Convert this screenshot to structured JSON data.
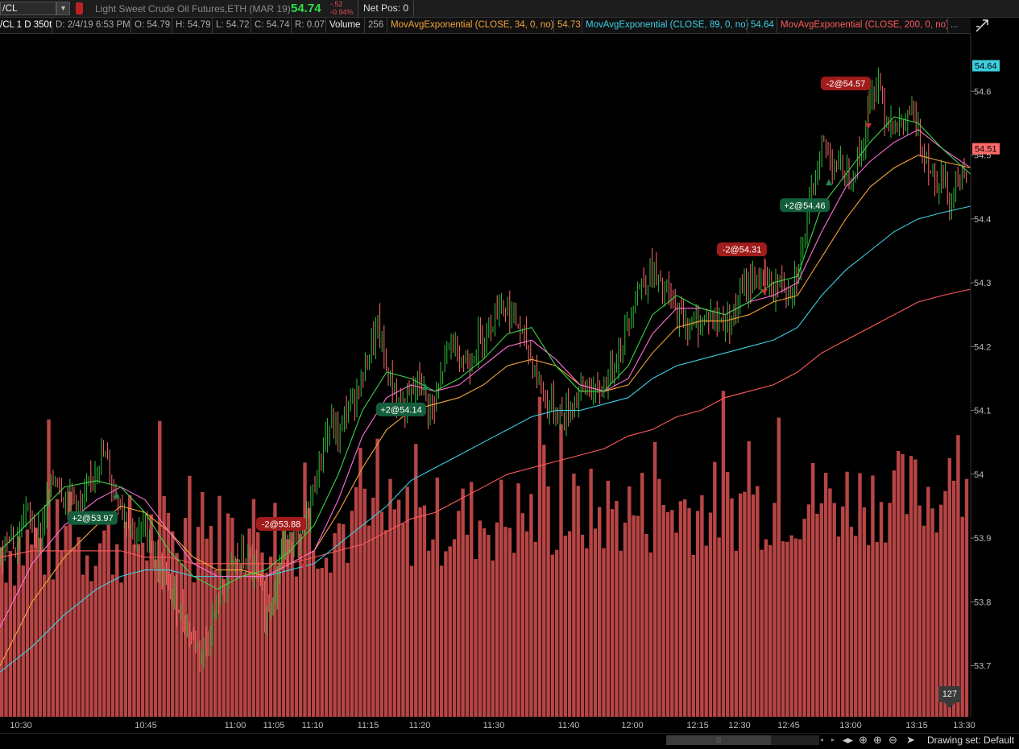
{
  "topbar": {
    "symbol": "/CL",
    "description": "Light Sweet Crude Oil Futures,ETH (MAR 19)",
    "last": "54.74",
    "net_change": "-.52",
    "pct_change": "-0.94%",
    "net_pos": "Net Pos: 0"
  },
  "infobar": {
    "label": "/CL 1 D 350t",
    "date": "D: 2/4/19 6:53 PM",
    "open": "O: 54.79",
    "high": "H: 54.79",
    "low": "L: 54.72",
    "close": "C: 54.74",
    "range": "R: 0.07",
    "volume_label": "Volume",
    "volume_value": "256",
    "ema34_label": "MovAvgExponential (CLOSE, 34, 0, no)",
    "ema34_value": "54.73",
    "ema89_label": "MovAvgExponential (CLOSE, 89, 0, no)",
    "ema89_value": "54.64",
    "ema200_label": "MovAvgExponential (CLOSE, 200, 0, no)",
    "more": "..."
  },
  "colors": {
    "up": "#2fbf3a",
    "down": "#ff6b6b",
    "volume": "#b84545",
    "ema_fast": "#3cd34a",
    "ema_pink": "#ff6fd8",
    "ema34": "#f2a33a",
    "ema89": "#3ccfe0",
    "ema200": "#ff5a5a",
    "buy_badge": "#155e3c",
    "sell_badge": "#a21c1c"
  },
  "chart_data": {
    "type": "candlestick",
    "y_ticks": [
      "54.6",
      "54.5",
      "54.4",
      "54.3",
      "54.2",
      "54.1",
      "54",
      "53.9",
      "53.8",
      "53.7"
    ],
    "ylim": [
      53.62,
      54.69
    ],
    "x_ticks": [
      "10:30",
      "10:45",
      "11:00",
      "11:05",
      "11:10",
      "11:15",
      "11:20",
      "11:30",
      "11:40",
      "12:00",
      "12:15",
      "12:30",
      "12:45",
      "13:00",
      "13:15",
      "13:30"
    ],
    "current_price_tag": "54.51",
    "ema89_tag": "54.64",
    "volume_badge": "127",
    "close_path": [
      [
        0,
        53.86
      ],
      [
        10,
        53.92
      ],
      [
        20,
        53.88
      ],
      [
        30,
        53.95
      ],
      [
        40,
        53.92
      ],
      [
        50,
        53.9
      ],
      [
        60,
        53.97
      ],
      [
        70,
        54.0
      ],
      [
        80,
        53.96
      ],
      [
        90,
        53.97
      ],
      [
        100,
        53.94
      ],
      [
        110,
        53.98
      ],
      [
        120,
        54.02
      ],
      [
        130,
        54.03
      ],
      [
        140,
        53.98
      ],
      [
        150,
        53.95
      ],
      [
        160,
        53.93
      ],
      [
        170,
        53.9
      ],
      [
        180,
        53.92
      ],
      [
        190,
        53.88
      ],
      [
        200,
        53.84
      ],
      [
        210,
        53.82
      ],
      [
        220,
        53.8
      ],
      [
        230,
        53.77
      ],
      [
        240,
        53.74
      ],
      [
        250,
        53.72
      ],
      [
        260,
        53.75
      ],
      [
        270,
        53.8
      ],
      [
        280,
        53.83
      ],
      [
        290,
        53.86
      ],
      [
        300,
        53.87
      ],
      [
        310,
        53.86
      ],
      [
        320,
        53.84
      ],
      [
        330,
        53.78
      ],
      [
        340,
        53.82
      ],
      [
        350,
        53.88
      ],
      [
        360,
        53.9
      ],
      [
        370,
        53.88
      ],
      [
        380,
        53.93
      ],
      [
        390,
        53.98
      ],
      [
        400,
        54.04
      ],
      [
        410,
        54.08
      ],
      [
        420,
        54.06
      ],
      [
        430,
        54.1
      ],
      [
        440,
        54.12
      ],
      [
        450,
        54.15
      ],
      [
        460,
        54.2
      ],
      [
        470,
        54.23
      ],
      [
        480,
        54.16
      ],
      [
        490,
        54.13
      ],
      [
        500,
        54.1
      ],
      [
        510,
        54.12
      ],
      [
        520,
        54.15
      ],
      [
        530,
        54.11
      ],
      [
        540,
        54.1
      ],
      [
        550,
        54.17
      ],
      [
        560,
        54.21
      ],
      [
        570,
        54.19
      ],
      [
        580,
        54.17
      ],
      [
        590,
        54.2
      ],
      [
        600,
        54.22
      ],
      [
        610,
        54.24
      ],
      [
        620,
        54.27
      ],
      [
        630,
        54.26
      ],
      [
        640,
        54.24
      ],
      [
        650,
        54.21
      ],
      [
        660,
        54.18
      ],
      [
        670,
        54.14
      ],
      [
        680,
        54.11
      ],
      [
        690,
        54.1
      ],
      [
        700,
        54.09
      ],
      [
        710,
        54.11
      ],
      [
        720,
        54.13
      ],
      [
        730,
        54.14
      ],
      [
        740,
        54.12
      ],
      [
        750,
        54.14
      ],
      [
        760,
        54.17
      ],
      [
        770,
        54.2
      ],
      [
        780,
        54.24
      ],
      [
        790,
        54.29
      ],
      [
        800,
        54.3
      ],
      [
        810,
        54.32
      ],
      [
        820,
        54.29
      ],
      [
        830,
        54.28
      ],
      [
        840,
        54.25
      ],
      [
        850,
        54.24
      ],
      [
        860,
        54.23
      ],
      [
        870,
        54.24
      ],
      [
        880,
        54.25
      ],
      [
        890,
        54.24
      ],
      [
        900,
        54.24
      ],
      [
        910,
        54.25
      ],
      [
        920,
        54.28
      ],
      [
        930,
        54.3
      ],
      [
        940,
        54.31
      ],
      [
        950,
        54.3
      ],
      [
        960,
        54.29
      ],
      [
        970,
        54.3
      ],
      [
        980,
        54.29
      ],
      [
        990,
        54.32
      ],
      [
        1000,
        54.38
      ],
      [
        1010,
        54.45
      ],
      [
        1020,
        54.52
      ],
      [
        1030,
        54.5
      ],
      [
        1040,
        54.48
      ],
      [
        1050,
        54.47
      ],
      [
        1060,
        54.48
      ],
      [
        1070,
        54.51
      ],
      [
        1080,
        54.58
      ],
      [
        1090,
        54.62
      ],
      [
        1100,
        54.56
      ],
      [
        1110,
        54.55
      ],
      [
        1120,
        54.54
      ],
      [
        1130,
        54.57
      ],
      [
        1140,
        54.53
      ],
      [
        1150,
        54.5
      ],
      [
        1160,
        54.46
      ],
      [
        1170,
        54.47
      ],
      [
        1180,
        54.43
      ],
      [
        1190,
        54.47
      ],
      [
        1200,
        54.45
      ]
    ],
    "ema_fast": [
      [
        0,
        53.88
      ],
      [
        40,
        53.93
      ],
      [
        80,
        53.98
      ],
      [
        120,
        53.99
      ],
      [
        150,
        53.98
      ],
      [
        180,
        53.94
      ],
      [
        210,
        53.88
      ],
      [
        240,
        53.84
      ],
      [
        270,
        53.82
      ],
      [
        300,
        53.84
      ],
      [
        330,
        53.85
      ],
      [
        360,
        53.88
      ],
      [
        390,
        53.92
      ],
      [
        420,
        54.0
      ],
      [
        450,
        54.1
      ],
      [
        480,
        54.16
      ],
      [
        510,
        54.15
      ],
      [
        540,
        54.13
      ],
      [
        570,
        54.15
      ],
      [
        600,
        54.18
      ],
      [
        630,
        54.22
      ],
      [
        660,
        54.23
      ],
      [
        690,
        54.17
      ],
      [
        720,
        54.13
      ],
      [
        750,
        54.13
      ],
      [
        780,
        54.17
      ],
      [
        810,
        54.25
      ],
      [
        840,
        54.28
      ],
      [
        870,
        54.26
      ],
      [
        900,
        54.25
      ],
      [
        930,
        54.27
      ],
      [
        960,
        54.3
      ],
      [
        990,
        54.31
      ],
      [
        1020,
        54.42
      ],
      [
        1050,
        54.47
      ],
      [
        1080,
        54.52
      ],
      [
        1110,
        54.56
      ],
      [
        1140,
        54.55
      ],
      [
        1170,
        54.51
      ],
      [
        1205,
        54.47
      ]
    ],
    "ema_pink": [
      [
        0,
        53.76
      ],
      [
        40,
        53.86
      ],
      [
        80,
        53.92
      ],
      [
        120,
        53.96
      ],
      [
        150,
        53.98
      ],
      [
        180,
        53.96
      ],
      [
        210,
        53.91
      ],
      [
        240,
        53.86
      ],
      [
        270,
        53.84
      ],
      [
        300,
        53.84
      ],
      [
        330,
        53.84
      ],
      [
        360,
        53.86
      ],
      [
        390,
        53.88
      ],
      [
        420,
        53.96
      ],
      [
        450,
        54.06
      ],
      [
        480,
        54.12
      ],
      [
        510,
        54.14
      ],
      [
        540,
        54.13
      ],
      [
        570,
        54.14
      ],
      [
        600,
        54.17
      ],
      [
        630,
        54.2
      ],
      [
        660,
        54.21
      ],
      [
        690,
        54.18
      ],
      [
        720,
        54.14
      ],
      [
        750,
        54.13
      ],
      [
        780,
        54.15
      ],
      [
        810,
        54.22
      ],
      [
        840,
        54.26
      ],
      [
        870,
        54.26
      ],
      [
        900,
        54.25
      ],
      [
        930,
        54.27
      ],
      [
        960,
        54.28
      ],
      [
        990,
        54.3
      ],
      [
        1020,
        54.38
      ],
      [
        1050,
        54.45
      ],
      [
        1080,
        54.49
      ],
      [
        1110,
        54.52
      ],
      [
        1140,
        54.54
      ],
      [
        1170,
        54.51
      ],
      [
        1205,
        54.48
      ]
    ],
    "ema34": [
      [
        0,
        53.7
      ],
      [
        40,
        53.8
      ],
      [
        80,
        53.87
      ],
      [
        120,
        53.92
      ],
      [
        150,
        53.95
      ],
      [
        180,
        53.94
      ],
      [
        210,
        53.91
      ],
      [
        240,
        53.87
      ],
      [
        270,
        53.85
      ],
      [
        300,
        53.85
      ],
      [
        330,
        53.84
      ],
      [
        360,
        53.86
      ],
      [
        390,
        53.88
      ],
      [
        420,
        53.94
      ],
      [
        450,
        54.01
      ],
      [
        480,
        54.07
      ],
      [
        510,
        54.1
      ],
      [
        540,
        54.11
      ],
      [
        570,
        54.12
      ],
      [
        600,
        54.14
      ],
      [
        630,
        54.17
      ],
      [
        660,
        54.18
      ],
      [
        690,
        54.17
      ],
      [
        720,
        54.14
      ],
      [
        750,
        54.13
      ],
      [
        780,
        54.14
      ],
      [
        810,
        54.19
      ],
      [
        840,
        54.23
      ],
      [
        870,
        54.24
      ],
      [
        900,
        54.24
      ],
      [
        930,
        54.25
      ],
      [
        960,
        54.27
      ],
      [
        990,
        54.28
      ],
      [
        1020,
        54.34
      ],
      [
        1050,
        54.4
      ],
      [
        1080,
        54.45
      ],
      [
        1110,
        54.48
      ],
      [
        1140,
        54.5
      ],
      [
        1170,
        54.49
      ],
      [
        1205,
        54.48
      ]
    ],
    "ema89": [
      [
        0,
        53.69
      ],
      [
        40,
        53.73
      ],
      [
        80,
        53.78
      ],
      [
        120,
        53.82
      ],
      [
        150,
        53.84
      ],
      [
        180,
        53.85
      ],
      [
        210,
        53.85
      ],
      [
        240,
        53.84
      ],
      [
        270,
        53.84
      ],
      [
        300,
        53.84
      ],
      [
        330,
        53.84
      ],
      [
        360,
        53.85
      ],
      [
        390,
        53.86
      ],
      [
        420,
        53.89
      ],
      [
        450,
        53.92
      ],
      [
        480,
        53.95
      ],
      [
        510,
        53.99
      ],
      [
        540,
        54.01
      ],
      [
        570,
        54.03
      ],
      [
        600,
        54.05
      ],
      [
        630,
        54.07
      ],
      [
        660,
        54.09
      ],
      [
        690,
        54.1
      ],
      [
        720,
        54.1
      ],
      [
        750,
        54.11
      ],
      [
        780,
        54.12
      ],
      [
        810,
        54.15
      ],
      [
        840,
        54.17
      ],
      [
        870,
        54.18
      ],
      [
        900,
        54.19
      ],
      [
        930,
        54.2
      ],
      [
        960,
        54.21
      ],
      [
        990,
        54.23
      ],
      [
        1020,
        54.28
      ],
      [
        1050,
        54.32
      ],
      [
        1080,
        54.35
      ],
      [
        1110,
        54.38
      ],
      [
        1140,
        54.4
      ],
      [
        1170,
        54.41
      ],
      [
        1205,
        54.42
      ]
    ],
    "ema200": [
      [
        0,
        53.87
      ],
      [
        40,
        53.88
      ],
      [
        80,
        53.88
      ],
      [
        120,
        53.88
      ],
      [
        150,
        53.88
      ],
      [
        180,
        53.87
      ],
      [
        210,
        53.87
      ],
      [
        240,
        53.86
      ],
      [
        270,
        53.86
      ],
      [
        300,
        53.86
      ],
      [
        330,
        53.86
      ],
      [
        360,
        53.86
      ],
      [
        390,
        53.87
      ],
      [
        420,
        53.88
      ],
      [
        450,
        53.89
      ],
      [
        480,
        53.91
      ],
      [
        510,
        53.93
      ],
      [
        540,
        53.94
      ],
      [
        570,
        53.96
      ],
      [
        600,
        53.98
      ],
      [
        630,
        54.0
      ],
      [
        660,
        54.01
      ],
      [
        690,
        54.02
      ],
      [
        720,
        54.03
      ],
      [
        750,
        54.04
      ],
      [
        780,
        54.06
      ],
      [
        810,
        54.07
      ],
      [
        840,
        54.09
      ],
      [
        870,
        54.1
      ],
      [
        900,
        54.12
      ],
      [
        930,
        54.13
      ],
      [
        960,
        54.14
      ],
      [
        990,
        54.16
      ],
      [
        1020,
        54.19
      ],
      [
        1050,
        54.21
      ],
      [
        1080,
        54.23
      ],
      [
        1110,
        54.25
      ],
      [
        1140,
        54.27
      ],
      [
        1170,
        54.28
      ],
      [
        1205,
        54.29
      ]
    ],
    "trades": [
      {
        "label": "+2@53.97",
        "side": "buy",
        "x": 115,
        "price": 53.97
      },
      {
        "label": "-2@53.88",
        "side": "sell",
        "x": 349,
        "price": 53.88
      },
      {
        "label": "+2@54.14",
        "side": "buy",
        "x": 498,
        "price": 54.14
      },
      {
        "label": "-2@54.31",
        "side": "sell",
        "x": 921,
        "price": 54.31
      },
      {
        "label": "+2@54.46",
        "side": "buy",
        "x": 999,
        "price": 54.46
      },
      {
        "label": "-2@54.57",
        "side": "sell",
        "x": 1050,
        "price": 54.57
      }
    ]
  },
  "bottombar": {
    "drawing_set": "Drawing set: Default",
    "tool_icons": [
      "scroll-left-icon",
      "scroll-right-icon",
      "zoom-fit-icon",
      "crosshair-icon",
      "zoom-in-icon",
      "zoom-out-icon",
      "cursor-icon"
    ]
  }
}
